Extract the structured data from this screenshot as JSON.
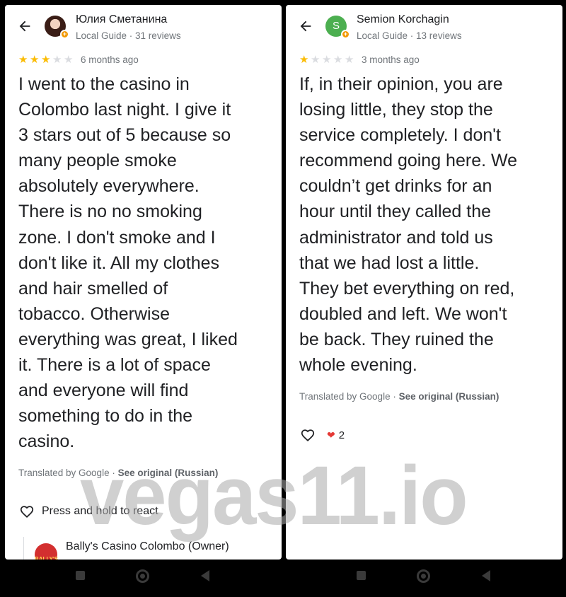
{
  "reviews": [
    {
      "reviewer": {
        "name": "Юлия Сметанина",
        "meta": "Local Guide · 31 reviews"
      },
      "rating": 3,
      "max_rating": 5,
      "time_ago": "6 months ago",
      "text": "I went to the casino in\nColombo last night. I give it\n3 stars out of 5 because so\nmany people smoke\nabsolutely everywhere.\nThere is no no smoking\nzone. I don't smoke and I\ndon't like it. All my clothes\nand hair smelled of\ntobacco. Otherwise\neverything was great, I liked\nit. There is a lot of space\nand everyone will find\nsomething to do in the\ncasino.",
      "translated_by": "Translated by Google · ",
      "see_original": "See original (Russian)",
      "react_label": "Press and hold to react",
      "owner_response": {
        "name": "Bally's Casino Colombo (Owner)",
        "logo_text": "BALLY'S"
      }
    },
    {
      "reviewer": {
        "name": "Semion Korchagin",
        "meta": "Local Guide · 13 reviews",
        "avatar_letter": "S"
      },
      "rating": 1,
      "max_rating": 5,
      "time_ago": "3 months ago",
      "text": "If, in their opinion, you are\nlosing little, they stop the\nservice completely. I don't\nrecommend going here. We\ncouldn’t get drinks for an\nhour until they called the\nadministrator and told us\nthat we had lost a little.\nThey bet everything on red,\ndoubled and left. We won't\nbe back. They ruined the\nwhole evening.",
      "translated_by": "Translated by Google · ",
      "see_original": "See original (Russian)",
      "reaction_count": "2"
    }
  ],
  "watermark": "vegas11.io",
  "icons": {
    "back": "arrow-left-icon",
    "star": "star-icon",
    "heart": "heart-outline-icon",
    "liked": "heart-filled-icon",
    "local_guide": "local-guide-badge-icon"
  },
  "colors": {
    "star_on": "#fbbc04",
    "star_off": "#dadce0",
    "heart": "#e53935",
    "avatar_green": "#4caf50",
    "badge": "#f29900"
  }
}
